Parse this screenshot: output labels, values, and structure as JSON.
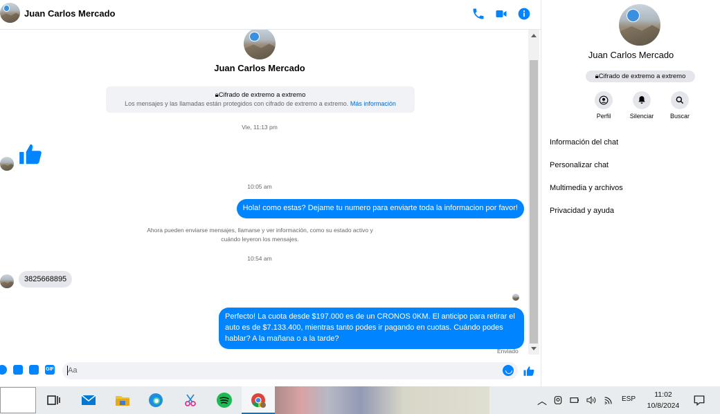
{
  "header": {
    "contact_name": "Juan Carlos Mercado"
  },
  "chat": {
    "profile_name": "Juan Carlos Mercado",
    "encryption_title": "Cifrado de extremo a extremo",
    "encryption_body": "Los mensajes y las llamadas están protegidos con cifrado de extremo a extremo.",
    "encryption_link": "Más información",
    "timestamps": [
      "Vie, 11:13 pm",
      "10:05 am",
      "10:54 am"
    ],
    "messages": [
      {
        "type": "like",
        "from": "contact"
      },
      {
        "type": "text",
        "from": "me",
        "text": "Hola! como estas? Dejame tu numero para enviarte toda la informacion por favor!"
      },
      {
        "type": "text",
        "from": "contact",
        "text": "3825668895"
      },
      {
        "type": "text",
        "from": "me",
        "text": "Perfecto! La cuota desde $197.000 es de un CRONOS 0KM. El anticipo para retirar el auto es de $7.133.400, mientras tanto podes ir pagando en cuotas. Cuándo podes hablar? A la mañana o a la tarde?"
      }
    ],
    "system_notice": "Ahora pueden enviarse mensajes, llamarse y ver información, como su estado activo y cuándo leyeron los mensajes.",
    "sent_status": "Enviado"
  },
  "composer": {
    "placeholder": "Aa",
    "gif_label": "GIF"
  },
  "right_panel": {
    "name": "Juan Carlos Mercado",
    "encryption_pill": "Cifrado de extremo a extremo",
    "actions": [
      "Perfil",
      "Silenciar",
      "Buscar"
    ],
    "menu": [
      "Información del chat",
      "Personalizar chat",
      "Multimedia y archivos",
      "Privacidad y ayuda"
    ]
  },
  "taskbar": {
    "language": "ESP",
    "time": "11:02",
    "date": "10/8/2024"
  },
  "colors": {
    "accent": "#0084ff",
    "incoming_bubble": "#e4e6eb",
    "link": "#0a66c2"
  }
}
